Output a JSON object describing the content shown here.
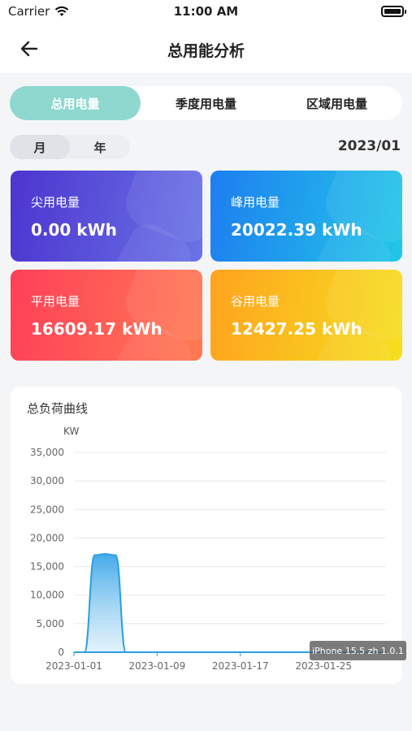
{
  "status_bar": {
    "carrier": "Carrier",
    "time": "11:00 AM"
  },
  "nav": {
    "title": "总用能分析"
  },
  "tabs": [
    {
      "label": "总用电量",
      "active": true
    },
    {
      "label": "季度用电量",
      "active": false
    },
    {
      "label": "区域用电量",
      "active": false
    }
  ],
  "period": {
    "options": [
      "月",
      "年"
    ],
    "selected": "月"
  },
  "date": "2023/01",
  "cards": [
    {
      "label": "尖用电量",
      "value": "0.00 kWh"
    },
    {
      "label": "峰用电量",
      "value": "20022.39 kWh"
    },
    {
      "label": "平用电量",
      "value": "16609.17 kWh"
    },
    {
      "label": "谷用电量",
      "value": "12427.25 kWh"
    }
  ],
  "chart_title": "总负荷曲线",
  "chart_data": {
    "type": "area",
    "title": "总负荷曲线",
    "ylabel": "KW",
    "ylim": [
      0,
      35000
    ],
    "yticks": [
      "0",
      "5,000",
      "10,000",
      "15,000",
      "20,000",
      "25,000",
      "30,000",
      "35,000"
    ],
    "xticks": [
      "2023-01-01",
      "2023-01-09",
      "2023-01-17",
      "2023-01-25"
    ],
    "xrange": [
      "2023-01-01",
      "2023-01-31"
    ],
    "x": [
      "2023-01-01",
      "2023-01-02",
      "2023-01-03",
      "2023-01-04",
      "2023-01-05",
      "2023-01-06",
      "2023-01-07",
      "2023-01-10",
      "2023-01-15",
      "2023-01-20",
      "2023-01-25",
      "2023-01-31"
    ],
    "values": [
      0,
      0,
      17000,
      17200,
      17000,
      0,
      0,
      0,
      0,
      0,
      0,
      0
    ],
    "color": "#2b9fe0"
  },
  "overlay": {
    "version": "iPhone 15.5 zh 1.0.1"
  }
}
